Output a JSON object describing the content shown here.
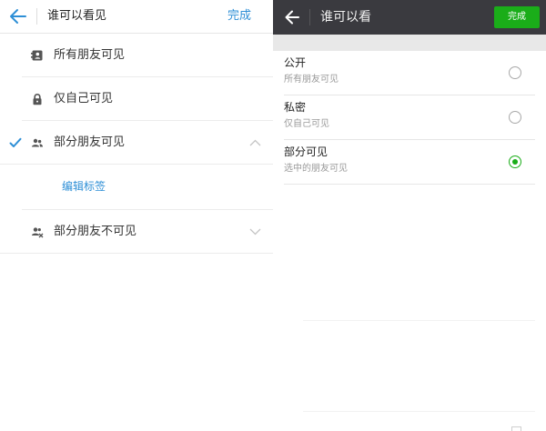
{
  "left_screen": {
    "header": {
      "back_icon": "back-arrow-icon",
      "title": "谁可以看见",
      "done_label": "完成"
    },
    "options": [
      {
        "icon": "contact-card-icon",
        "label": "所有朋友可见",
        "checked": false
      },
      {
        "icon": "lock-icon",
        "label": "仅自己可见",
        "checked": false
      },
      {
        "icon": "group-people-icon",
        "label": "部分朋友可见",
        "checked": true,
        "expanded": true,
        "chevron": "chevron-up-icon"
      },
      {
        "icon": "group-block-icon",
        "label": "部分朋友不可见",
        "checked": false,
        "expanded": false,
        "chevron": "chevron-down-icon"
      }
    ],
    "edit_tags_label": "编辑标签",
    "colors": {
      "accent": "#2e8fd6"
    }
  },
  "right_screen": {
    "header": {
      "back_icon": "back-arrow-icon",
      "title": "谁可以看",
      "done_label": "完成"
    },
    "options": [
      {
        "title": "公开",
        "subtitle": "所有朋友可见",
        "selected": false
      },
      {
        "title": "私密",
        "subtitle": "仅自己可见",
        "selected": false
      },
      {
        "title": "部分可见",
        "subtitle": "选中的朋友可见",
        "selected": true
      }
    ],
    "colors": {
      "header_bg": "#3a3a3f",
      "accent": "#1aad19"
    }
  }
}
